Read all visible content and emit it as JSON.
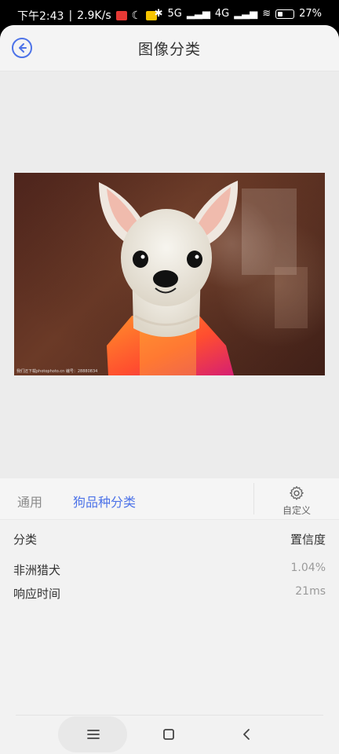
{
  "status": {
    "time": "下午2:43",
    "speed": "2.9K/s",
    "badge_red": "",
    "badge_yellow": "",
    "battery_percent": "27%",
    "signal_5g": "5G",
    "signal_4g": "4G"
  },
  "header": {
    "title": "图像分类",
    "back_icon": "arrow-left-icon"
  },
  "image": {
    "subject": "chihuahua-dog-photo",
    "watermark": "我们还下载photophoto.cn 编号：28880834"
  },
  "tabs": {
    "general": "通用",
    "dog_breed": "狗品种分类",
    "custom": "自定义",
    "custom_icon": "gear-icon"
  },
  "results": {
    "header_left": "分类",
    "header_right": "置信度",
    "class_name": "非洲猎犬",
    "confidence": "1.04%",
    "latency_label": "响应时间",
    "latency_value": "21ms"
  },
  "colors": {
    "accent": "#4d73e8",
    "background": "#f2f2f2"
  }
}
